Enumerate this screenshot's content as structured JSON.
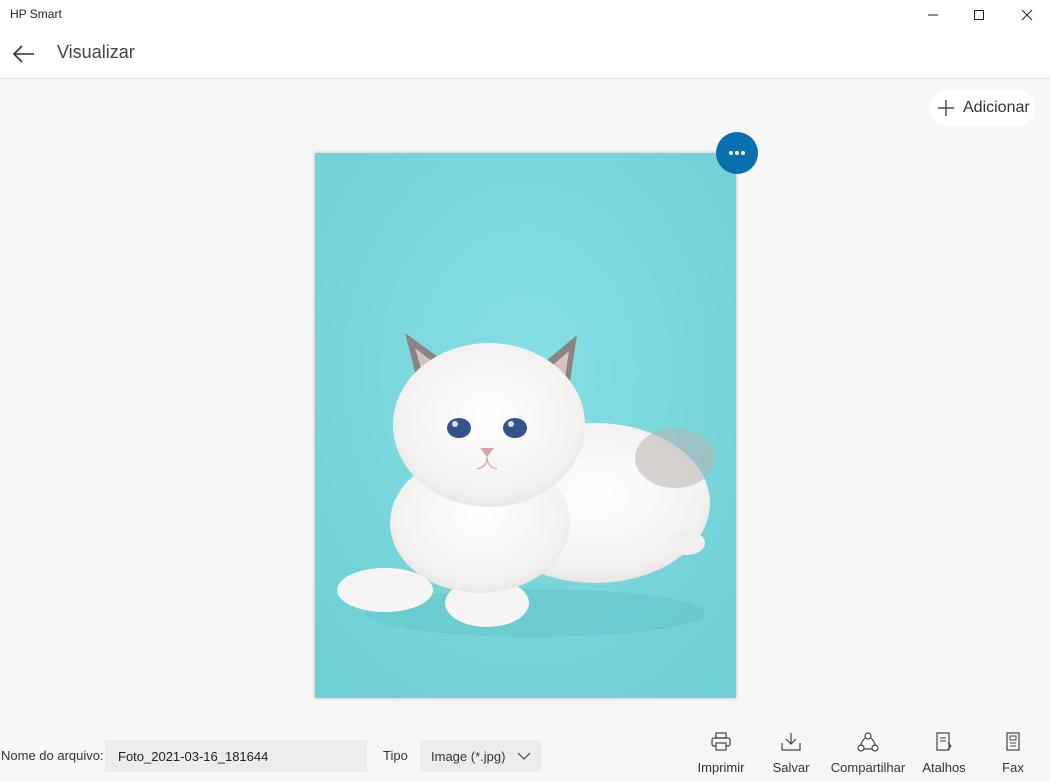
{
  "window": {
    "app_title": "HP Smart",
    "controls": [
      "minimize-icon",
      "maximize-icon",
      "close-icon"
    ]
  },
  "header": {
    "back_icon": "arrow-left-icon",
    "title": "Visualizar"
  },
  "toolbar": {
    "add_label": "Adicionar",
    "add_icon": "plus-icon",
    "more_icon": "ellipsis-icon"
  },
  "preview": {
    "subject": "photo of a white kitten on a turquoise background",
    "background_color": "#7ed9df"
  },
  "footer": {
    "filename_label": "Nome do arquivo:",
    "filename_value": "Foto_2021-03-16_181644",
    "type_label": "Tipo",
    "type_value": "Image (*.jpg)",
    "actions": [
      {
        "label": "Imprimir",
        "icon": "printer-icon"
      },
      {
        "label": "Salvar",
        "icon": "download-icon"
      },
      {
        "label": "Compartilhar",
        "icon": "share-icon"
      },
      {
        "label": "Atalhos",
        "icon": "shortcut-icon"
      },
      {
        "label": "Fax",
        "icon": "fax-icon"
      }
    ]
  },
  "colors": {
    "accent": "#0a6fae",
    "background": "#f7f7f7"
  }
}
